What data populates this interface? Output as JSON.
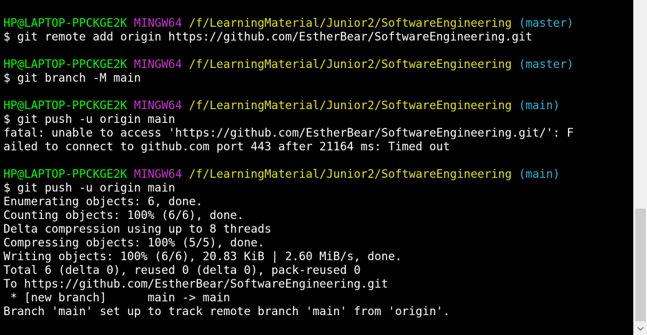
{
  "terminal": {
    "lines": [
      [
        {
          "t": "HP@LAPTOP-PPCKGE2K",
          "c": "user"
        },
        {
          "t": " ",
          "c": "out"
        },
        {
          "t": "MINGW64",
          "c": "shell"
        },
        {
          "t": " ",
          "c": "out"
        },
        {
          "t": "/f/LearningMaterial/Junior2/SoftwareEngineering",
          "c": "path"
        },
        {
          "t": " ",
          "c": "out"
        },
        {
          "t": "(master)",
          "c": "branch"
        }
      ],
      [
        {
          "t": "$ git remote add origin https://github.com/EstherBear/SoftwareEngineering.git",
          "c": "out"
        }
      ],
      [
        {
          "t": "",
          "c": "out"
        }
      ],
      [
        {
          "t": "HP@LAPTOP-PPCKGE2K",
          "c": "user"
        },
        {
          "t": " ",
          "c": "out"
        },
        {
          "t": "MINGW64",
          "c": "shell"
        },
        {
          "t": " ",
          "c": "out"
        },
        {
          "t": "/f/LearningMaterial/Junior2/SoftwareEngineering",
          "c": "path"
        },
        {
          "t": " ",
          "c": "out"
        },
        {
          "t": "(master)",
          "c": "branch"
        }
      ],
      [
        {
          "t": "$ git branch -M main",
          "c": "out"
        }
      ],
      [
        {
          "t": "",
          "c": "out"
        }
      ],
      [
        {
          "t": "HP@LAPTOP-PPCKGE2K",
          "c": "user"
        },
        {
          "t": " ",
          "c": "out"
        },
        {
          "t": "MINGW64",
          "c": "shell"
        },
        {
          "t": " ",
          "c": "out"
        },
        {
          "t": "/f/LearningMaterial/Junior2/SoftwareEngineering",
          "c": "path"
        },
        {
          "t": " ",
          "c": "out"
        },
        {
          "t": "(main)",
          "c": "branch"
        }
      ],
      [
        {
          "t": "$ git push -u origin main",
          "c": "out"
        }
      ],
      [
        {
          "t": "fatal: unable to access 'https://github.com/EstherBear/SoftwareEngineering.git/': F",
          "c": "out"
        }
      ],
      [
        {
          "t": "ailed to connect to github.com port 443 after 21164 ms: Timed out",
          "c": "out"
        }
      ],
      [
        {
          "t": "",
          "c": "out"
        }
      ],
      [
        {
          "t": "HP@LAPTOP-PPCKGE2K",
          "c": "user"
        },
        {
          "t": " ",
          "c": "out"
        },
        {
          "t": "MINGW64",
          "c": "shell"
        },
        {
          "t": " ",
          "c": "out"
        },
        {
          "t": "/f/LearningMaterial/Junior2/SoftwareEngineering",
          "c": "path"
        },
        {
          "t": " ",
          "c": "out"
        },
        {
          "t": "(main)",
          "c": "branch"
        }
      ],
      [
        {
          "t": "$ git push -u origin main",
          "c": "out"
        }
      ],
      [
        {
          "t": "Enumerating objects: 6, done.",
          "c": "out"
        }
      ],
      [
        {
          "t": "Counting objects: 100% (6/6), done.",
          "c": "out"
        }
      ],
      [
        {
          "t": "Delta compression using up to 8 threads",
          "c": "out"
        }
      ],
      [
        {
          "t": "Compressing objects: 100% (5/5), done.",
          "c": "out"
        }
      ],
      [
        {
          "t": "Writing objects: 100% (6/6), 20.83 KiB | 2.60 MiB/s, done.",
          "c": "out"
        }
      ],
      [
        {
          "t": "Total 6 (delta 0), reused 0 (delta 0), pack-reused 0",
          "c": "out"
        }
      ],
      [
        {
          "t": "To https://github.com/EstherBear/SoftwareEngineering.git",
          "c": "out"
        }
      ],
      [
        {
          "t": " * [new branch]      main -> main",
          "c": "out"
        }
      ],
      [
        {
          "t": "Branch 'main' set up to track remote branch 'main' from 'origin'.",
          "c": "out"
        }
      ]
    ]
  },
  "scrollbar": {
    "down_icon": "chevron-down-icon"
  }
}
